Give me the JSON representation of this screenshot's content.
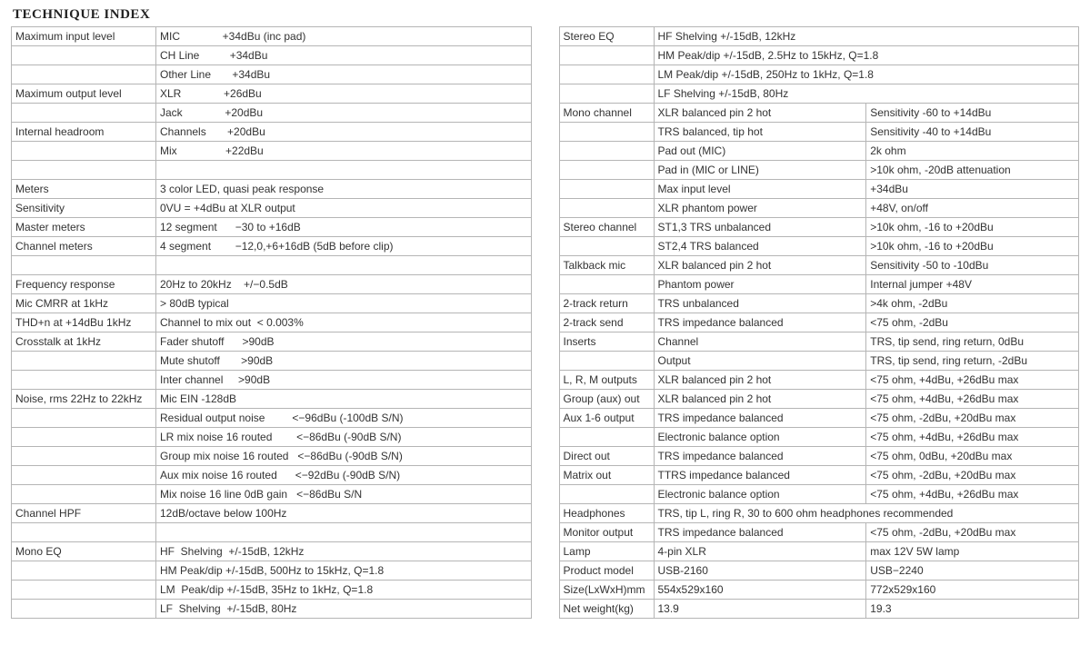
{
  "title": "TECHNIQUE INDEX",
  "left_rows": [
    [
      "Maximum input level",
      "MIC              +34dBu (inc pad)"
    ],
    [
      "",
      "CH Line          +34dBu"
    ],
    [
      "",
      "Other Line       +34dBu"
    ],
    [
      "Maximum output level",
      "XLR              +26dBu"
    ],
    [
      "",
      "Jack              +20dBu"
    ],
    [
      "Internal headroom",
      "Channels       +20dBu"
    ],
    [
      "",
      "Mix                +22dBu"
    ],
    [
      "",
      ""
    ],
    [
      "Meters",
      "3 color LED, quasi peak response"
    ],
    [
      "Sensitivity",
      "0VU = +4dBu at XLR output"
    ],
    [
      "Master meters",
      "12 segment      −30 to +16dB"
    ],
    [
      "Channel meters",
      "4 segment        −12,0,+6+16dB (5dB before clip)"
    ],
    [
      "",
      ""
    ],
    [
      "Frequency response",
      "20Hz to 20kHz    +/−0.5dB"
    ],
    [
      "Mic CMRR at 1kHz",
      "> 80dB typical"
    ],
    [
      "THD+n at +14dBu 1kHz",
      "Channel to mix out  < 0.003%"
    ],
    [
      "Crosstalk at 1kHz",
      "Fader shutoff      >90dB"
    ],
    [
      "",
      "Mute shutoff       >90dB"
    ],
    [
      "",
      "Inter channel     >90dB"
    ],
    [
      "Noise, rms 22Hz to 22kHz",
      "Mic EIN -128dB"
    ],
    [
      "",
      "Residual output noise         <−96dBu (-100dB S/N)"
    ],
    [
      "",
      "LR mix noise 16 routed        <−86dBu (-90dB S/N)"
    ],
    [
      "",
      "Group mix noise 16 routed   <−86dBu (-90dB S/N)"
    ],
    [
      "",
      "Aux mix noise 16 routed      <−92dBu (-90dB S/N)"
    ],
    [
      "",
      "Mix noise 16 line 0dB gain   <−86dBu S/N"
    ],
    [
      "Channel HPF",
      "12dB/octave below 100Hz"
    ],
    [
      "",
      ""
    ],
    [
      "Mono EQ",
      "HF  Shelving  +/-15dB, 12kHz"
    ],
    [
      "",
      "HM Peak/dip +/-15dB, 500Hz to 15kHz, Q=1.8"
    ],
    [
      "",
      "LM  Peak/dip +/-15dB, 35Hz to 1kHz, Q=1.8"
    ],
    [
      "",
      "LF  Shelving  +/-15dB, 80Hz"
    ]
  ],
  "right_rows": [
    [
      "Stereo EQ",
      "HF Shelving  +/-15dB, 12kHz",
      null
    ],
    [
      "",
      "HM Peak/dip  +/-15dB, 2.5Hz to 15kHz, Q=1.8",
      null
    ],
    [
      "",
      "LM Peak/dip  +/-15dB, 250Hz to 1kHz, Q=1.8",
      null
    ],
    [
      "",
      "LF  Shelving  +/-15dB, 80Hz",
      null
    ],
    [
      "Mono channel",
      "XLR balanced pin 2 hot",
      "Sensitivity -60 to +14dBu"
    ],
    [
      "",
      "TRS balanced, tip hot",
      "Sensitivity -40 to +14dBu"
    ],
    [
      "",
      "Pad out (MIC)",
      "2k ohm"
    ],
    [
      "",
      "Pad in (MIC or LINE)",
      ">10k ohm, -20dB attenuation"
    ],
    [
      "",
      "Max input level",
      "+34dBu"
    ],
    [
      "",
      "XLR phantom power",
      "+48V, on/off"
    ],
    [
      "Stereo channel",
      "ST1,3  TRS unbalanced",
      ">10k ohm, -16 to +20dBu"
    ],
    [
      "",
      "ST2,4  TRS balanced",
      ">10k ohm, -16 to +20dBu"
    ],
    [
      "Talkback mic",
      "XLR balanced pin 2 hot",
      "Sensitivity -50 to -10dBu"
    ],
    [
      "",
      "Phantom power",
      "Internal jumper +48V"
    ],
    [
      "2-track return",
      "TRS unbalanced",
      ">4k ohm, -2dBu"
    ],
    [
      "2-track send",
      "TRS impedance balanced",
      "<75 ohm, -2dBu"
    ],
    [
      "Inserts",
      "Channel",
      "TRS, tip send, ring return, 0dBu"
    ],
    [
      "",
      "Output",
      "TRS, tip send, ring return, -2dBu"
    ],
    [
      "L, R, M outputs",
      "XLR balanced pin 2 hot",
      "<75 ohm, +4dBu, +26dBu max"
    ],
    [
      "Group (aux) out",
      "XLR balanced pin 2 hot",
      "<75 ohm, +4dBu, +26dBu max"
    ],
    [
      "Aux 1-6 output",
      "TRS impedance balanced",
      "<75 ohm, -2dBu, +20dBu max"
    ],
    [
      "",
      "Electronic balance option",
      "<75 ohm, +4dBu, +26dBu max"
    ],
    [
      "Direct out",
      "TRS impedance balanced",
      "<75 ohm, 0dBu, +20dBu max"
    ],
    [
      "Matrix out",
      "TTRS impedance balanced",
      "<75 ohm, -2dBu, +20dBu max"
    ],
    [
      "",
      "Electronic balance option",
      "<75 ohm, +4dBu, +26dBu max"
    ],
    [
      "Headphones",
      "TRS, tip L, ring R, 30 to 600 ohm headphones recommended",
      null
    ],
    [
      "Monitor output",
      "TRS impedance balanced",
      "<75 ohm, -2dBu, +20dBu max"
    ],
    [
      "Lamp",
      "4-pin XLR",
      "max 12V 5W lamp"
    ],
    [
      "Product model",
      "USB-2160",
      "USB−2240"
    ],
    [
      "Size(LxWxH)mm",
      "554x529x160",
      "772x529x160"
    ],
    [
      "Net weight(kg)",
      "13.9",
      "19.3"
    ]
  ]
}
